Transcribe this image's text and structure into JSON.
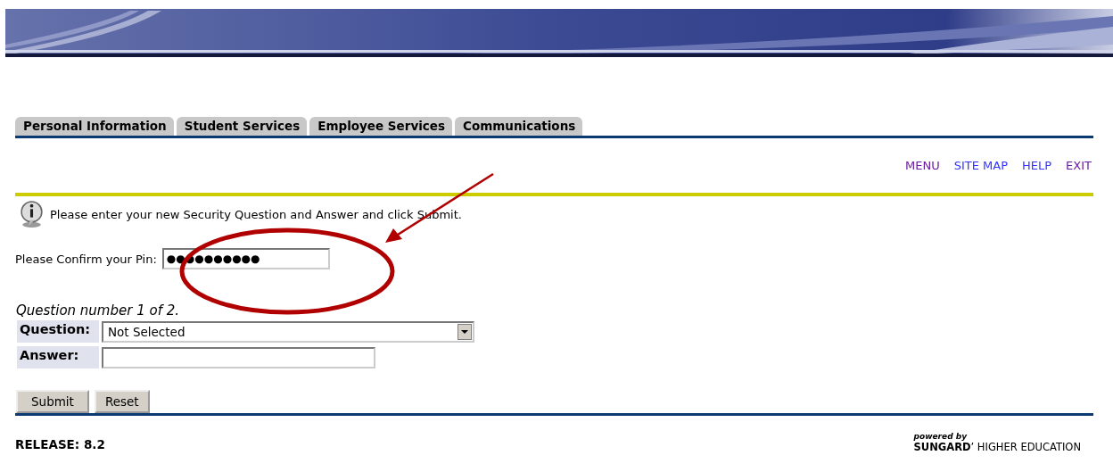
{
  "tabs": [
    {
      "label": "Personal Information",
      "selected": false
    },
    {
      "label": "Student Services",
      "selected": false
    },
    {
      "label": "Employee Services",
      "selected": false
    },
    {
      "label": "Communications",
      "selected": false
    }
  ],
  "top_links": [
    {
      "label": "MENU",
      "visited": true
    },
    {
      "label": "SITE MAP",
      "visited": false
    },
    {
      "label": "HELP",
      "visited": false
    },
    {
      "label": "EXIT",
      "visited": true
    }
  ],
  "info_message": "Please enter your new Security Question and Answer and click Submit.",
  "pin": {
    "label": "Please Confirm your Pin:",
    "value": "●●●●●●●●●●"
  },
  "question_heading": "Question number 1 of 2.",
  "question": {
    "label": "Question:",
    "value": "Not Selected"
  },
  "answer": {
    "label": "Answer:"
  },
  "buttons": [
    "Submit",
    "Reset"
  ],
  "release": "RELEASE: 8.2",
  "footer_logo": {
    "tagline": "powered by",
    "name": "**SUNGARD**’ HIGHER EDUCATION"
  }
}
